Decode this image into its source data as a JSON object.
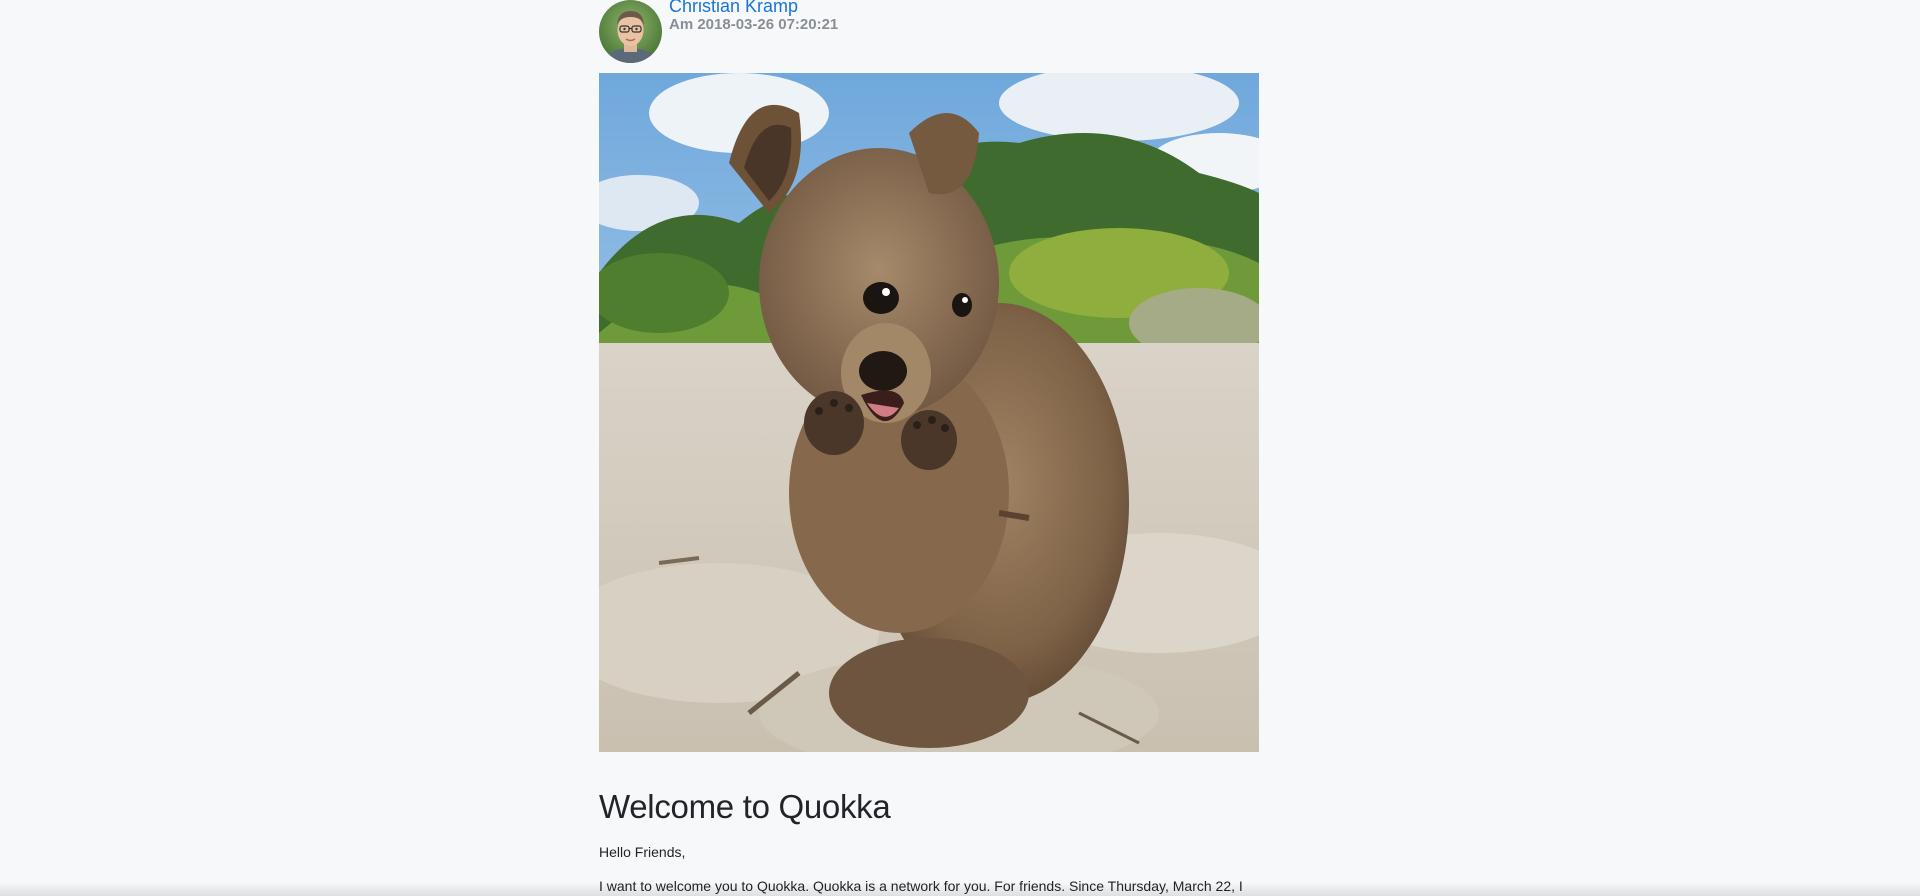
{
  "post": {
    "author": {
      "name": "Christian Kramp",
      "avatar_icon": "profile-photo-icon"
    },
    "date": "Am 2018-03-26 07:20:21",
    "image": {
      "subject": "quokka-photo-icon"
    },
    "title": "Welcome to Quokka",
    "paragraphs": [
      "Hello Friends,",
      "I want to welcome you to Quokka. Quokka is a network for you. For friends. Since Thursday, March 22, I"
    ]
  },
  "colors": {
    "background": "#f7f8fa",
    "link": "#1a73d9",
    "meta": "#888e95",
    "text": "#212529"
  }
}
